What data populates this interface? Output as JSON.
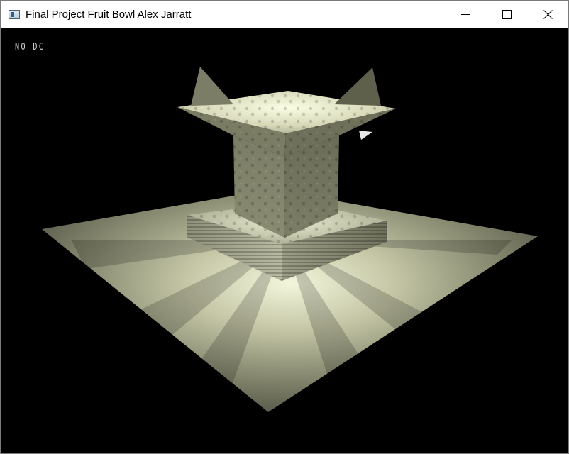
{
  "window": {
    "title": "Final Project Fruit Bowl Alex Jarratt",
    "icon": "application-window-icon",
    "controls": [
      "minimize",
      "maximize",
      "close"
    ]
  },
  "viewport": {
    "overlay_text": "NO DC",
    "scene": "3D fruit bowl render",
    "colors": {
      "background": "#000000",
      "surface_light": "#eef0d6",
      "surface_mid": "#a8aa8c",
      "surface_dark": "#5a5c48",
      "overlay_text": "#cfcfcf"
    }
  }
}
